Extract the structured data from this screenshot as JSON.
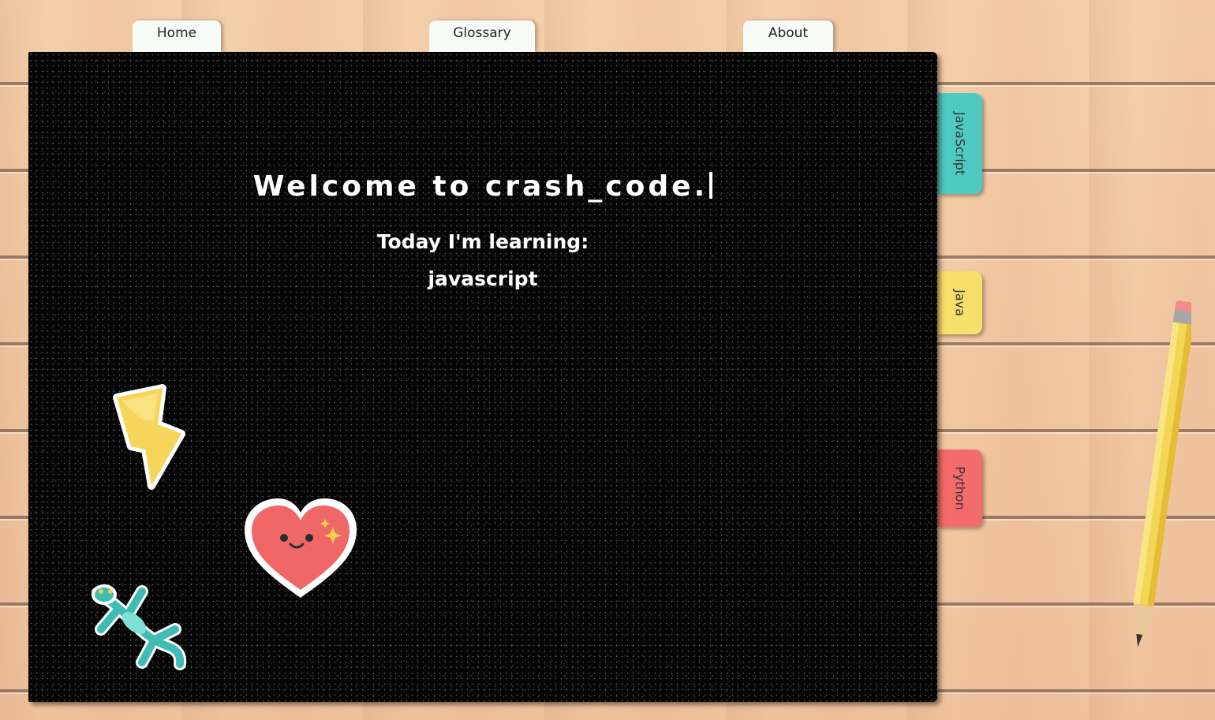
{
  "nav": {
    "home": "Home",
    "glossary": "Glossary",
    "about": "About"
  },
  "board": {
    "headline": "Welcome to crash_code.",
    "learning_label": "Today I'm learning:",
    "learning_value": "javascript"
  },
  "side_tabs": {
    "javascript": "JavaScript",
    "java": "Java",
    "python": "Python"
  },
  "colors": {
    "javascript_tab": "#4fcac0",
    "java_tab": "#f8de6a",
    "python_tab": "#f46b6b",
    "board": "#050505"
  },
  "stickers": [
    "lightning-bolt-sticker",
    "heart-sticker",
    "gecko-sticker"
  ]
}
